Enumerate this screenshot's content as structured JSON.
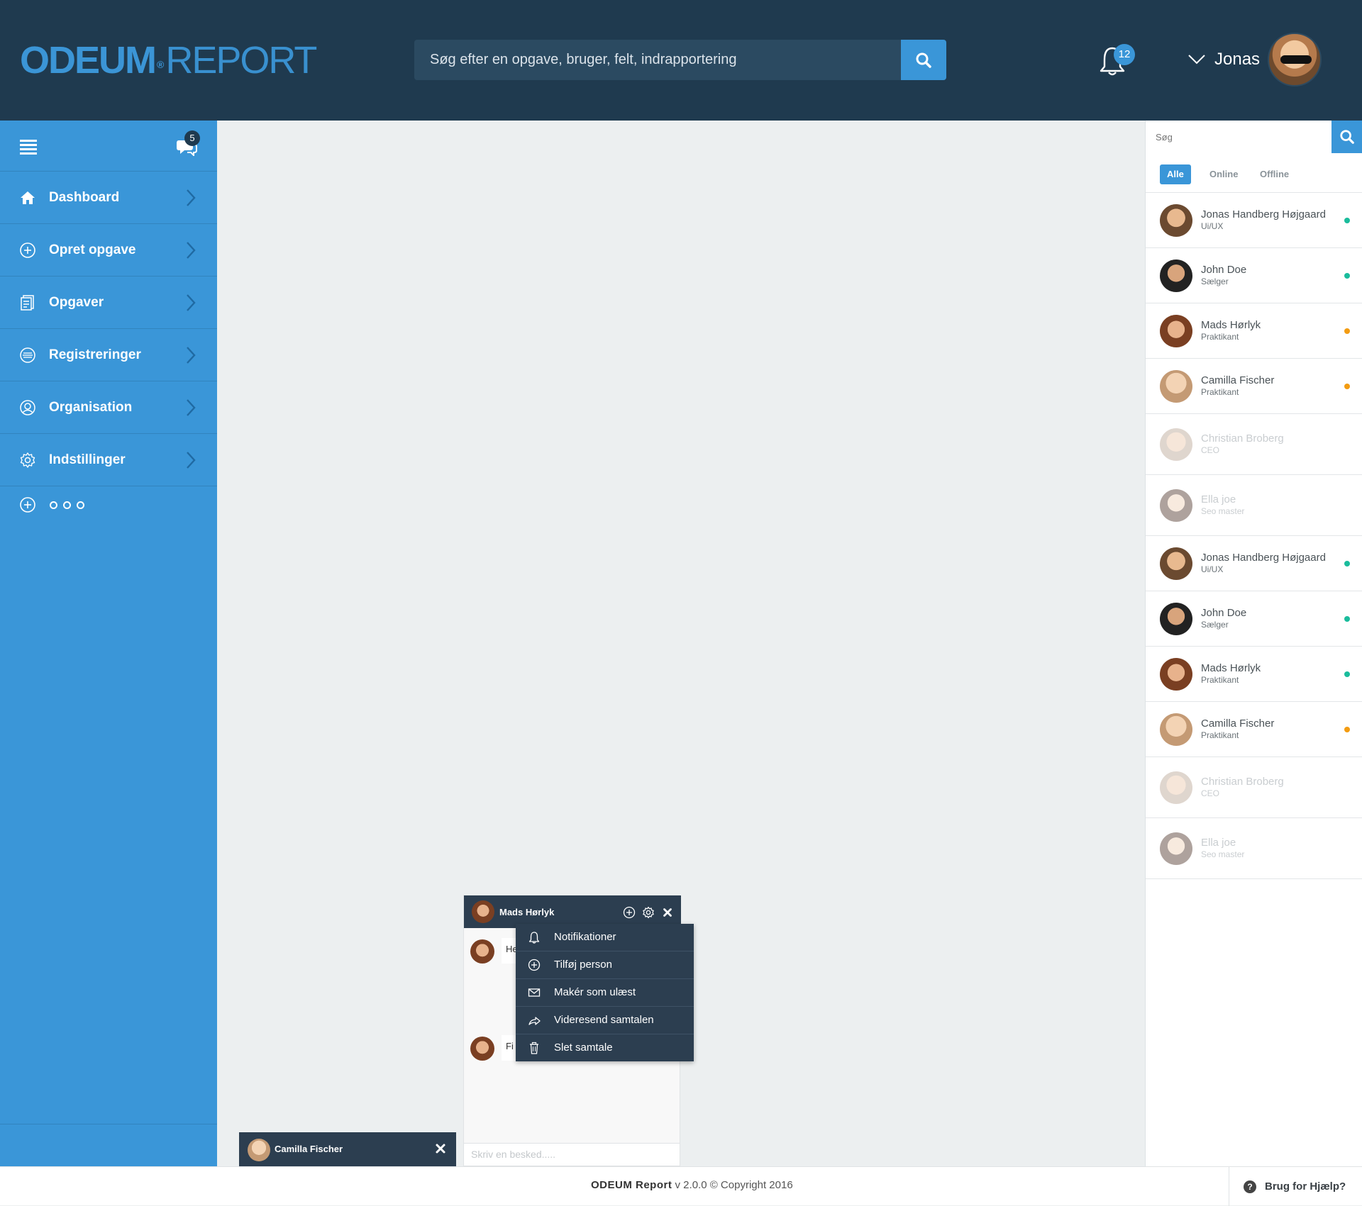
{
  "header": {
    "logo_a": "ODEUM",
    "logo_reg": "®",
    "logo_b": "REPORT",
    "search_placeholder": "Søg efter en opgave, bruger, felt, indrapportering",
    "notifications_count": "12",
    "user_name": "Jonas"
  },
  "sidebar": {
    "chat_badge": "5",
    "items": [
      {
        "label": "Dashboard",
        "icon": "home-icon"
      },
      {
        "label": "Opret opgave",
        "icon": "plus-circle-icon"
      },
      {
        "label": "Opgaver",
        "icon": "tasks-icon"
      },
      {
        "label": "Registreringer",
        "icon": "registrations-icon"
      },
      {
        "label": "Organisation",
        "icon": "organisation-icon"
      },
      {
        "label": "Indstillinger",
        "icon": "gear-icon"
      }
    ]
  },
  "contacts": {
    "search_placeholder": "Søg",
    "tabs": [
      "Alle",
      "Online",
      "Offline"
    ],
    "active_tab": "Alle",
    "list": [
      {
        "name": "Jonas Handberg Højgaard",
        "role": "Ui/UX",
        "status": "online"
      },
      {
        "name": "John Doe",
        "role": "Sælger",
        "status": "online"
      },
      {
        "name": "Mads Hørlyk",
        "role": "Praktikant",
        "status": "away"
      },
      {
        "name": "Camilla Fischer",
        "role": "Praktikant",
        "status": "away"
      },
      {
        "name": "Christian Broberg",
        "role": "CEO",
        "status": "offline"
      },
      {
        "name": "Ella joe",
        "role": "Seo master",
        "status": "offline"
      },
      {
        "name": "Jonas Handberg Højgaard",
        "role": "Ui/UX",
        "status": "online"
      },
      {
        "name": "John Doe",
        "role": "Sælger",
        "status": "online"
      },
      {
        "name": "Mads Hørlyk",
        "role": "Praktikant",
        "status": "online"
      },
      {
        "name": "Camilla Fischer",
        "role": "Praktikant",
        "status": "away"
      },
      {
        "name": "Christian Broberg",
        "role": "CEO",
        "status": "offline"
      },
      {
        "name": "Ella joe",
        "role": "Seo master",
        "status": "offline"
      }
    ],
    "status_colors": {
      "online": "#1abc9c",
      "away": "#f39c12",
      "offline": "transparent"
    }
  },
  "chat_minimized": {
    "name": "Camilla Fischer"
  },
  "chat_window": {
    "name": "Mads Hørlyk",
    "messages": [
      {
        "text": "He"
      },
      {
        "text": "Fi"
      }
    ],
    "input_placeholder": "Skriv en besked....."
  },
  "chat_menu": {
    "items": [
      {
        "label": "Notifikationer",
        "icon": "bell-icon"
      },
      {
        "label": "Tilføj person",
        "icon": "add-person-icon"
      },
      {
        "label": "Makér som ulæst",
        "icon": "envelope-icon"
      },
      {
        "label": "Videresend samtalen",
        "icon": "forward-icon"
      },
      {
        "label": "Slet samtale",
        "icon": "trash-icon"
      }
    ]
  },
  "footer": {
    "brand": "ODEUM Report",
    "version_text": " v 2.0.0 © Copyright 2016",
    "help_label": "Brug for Hjælp?"
  },
  "colors": {
    "header": "#1f3a4f",
    "accent": "#3a96d8",
    "dark_panel": "#2c3e50"
  }
}
